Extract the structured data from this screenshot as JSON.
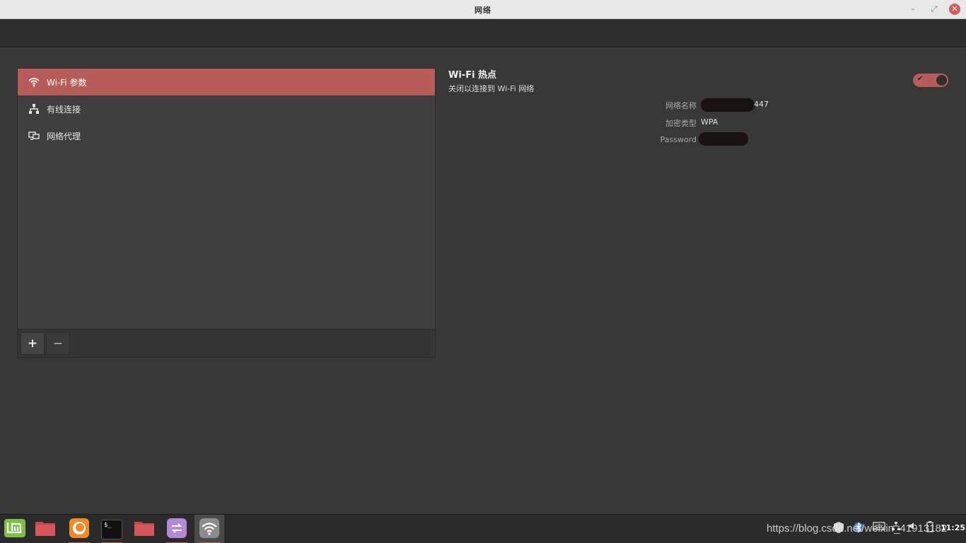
{
  "window": {
    "title": "网络",
    "minimize_glyph": "–",
    "maximize_glyph": "⤢",
    "close_glyph": "✕"
  },
  "sidebar": {
    "items": [
      {
        "label": "Wi-Fi 参数",
        "icon": "wifi-icon",
        "active": true
      },
      {
        "label": "有线连接",
        "icon": "wired-network-icon",
        "active": false
      },
      {
        "label": "网络代理",
        "icon": "proxy-icon",
        "active": false
      }
    ],
    "add_label": "+",
    "remove_label": "−"
  },
  "hotspot": {
    "title": "Wi-Fi 热点",
    "subtitle": "关闭以连接到 Wi-Fi 网络",
    "toggle_on": true,
    "toggle_check": "✔",
    "fields": [
      {
        "label": "网络名称",
        "value": "447"
      },
      {
        "label": "加密类型",
        "value": "WPA"
      },
      {
        "label": "Password",
        "value": ""
      }
    ]
  },
  "taskbar": {
    "items": [
      {
        "name": "mint-menu-icon"
      },
      {
        "name": "folder-icon"
      },
      {
        "name": "firefox-icon"
      },
      {
        "name": "terminal-icon"
      },
      {
        "name": "files-icon"
      },
      {
        "name": "transfer-app-icon"
      },
      {
        "name": "network-settings-icon"
      }
    ],
    "terminal_glyph": "$_",
    "watermark": "https://blog.csdn.net/weixin_41913182",
    "clock": "11:25"
  },
  "colors": {
    "accent": "#b85c5a",
    "background": "#383838",
    "panel": "#3f3f3f",
    "titlebar": "#e8e8e8"
  }
}
